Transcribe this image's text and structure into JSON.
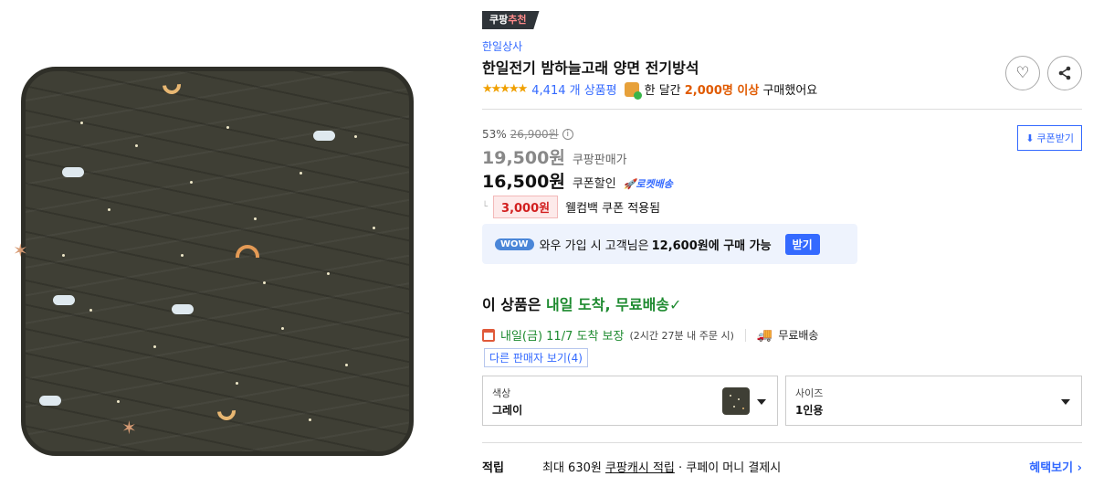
{
  "badge": {
    "prefix": "쿠팡",
    "highlight": "추천"
  },
  "seller": "한일상사",
  "title": "한일전기 밤하늘고래 양면 전기방석",
  "rating": {
    "stars_glyph": "★★★★★",
    "stars_value": 4.5,
    "review_count": "4,414 개 상품평"
  },
  "bought": {
    "pre": "한 달간",
    "highlight": "2,000명 이상",
    "post": "구매했어요"
  },
  "actions": {
    "wishlist_icon": "heart-icon",
    "share_icon": "share-icon"
  },
  "pricing": {
    "discount_rate": "53%",
    "original_price": "26,900원",
    "info_glyph": "i",
    "sale_price": "19,500원",
    "sale_label": "쿠팡판매가",
    "coupon_price": "16,500원",
    "coupon_label": "쿠폰할인",
    "rocket_label": "🚀로켓배송",
    "coupon_button": "쿠폰받기",
    "welcome_lead": "└",
    "welcome_amount": "3,000원",
    "welcome_text": "웰컴백 쿠폰 적용됨"
  },
  "wow": {
    "badge": "WOW",
    "pre": "와우 가입 시 고객님은",
    "amount": "12,600원에 구매 가능",
    "button": "받기"
  },
  "delivery": {
    "head_pre": "이 상품은",
    "head_highlight": "내일 도착, 무료배송",
    "check": "✓",
    "arrival": "내일(금) 11/7 도착 보장",
    "arrival_sub": "(2시간 27분 내 주문 시)",
    "free_shipping": "무료배송",
    "truck_glyph": "🚚",
    "other_sellers": "다른 판매자 보기(4)"
  },
  "options": {
    "color": {
      "label": "색상",
      "value": "그레이"
    },
    "size": {
      "label": "사이즈",
      "value": "1인용"
    }
  },
  "points": {
    "header": "적립",
    "pre": "최대 630원",
    "link": "쿠팡캐시 적립",
    "post": "· 쿠페이 머니 결제시",
    "benefit": "혜택보기 ›"
  },
  "colors": {
    "accent": "#346aff",
    "green": "#1d8a2f",
    "orange": "#e05a00",
    "red": "#d21f1f"
  }
}
